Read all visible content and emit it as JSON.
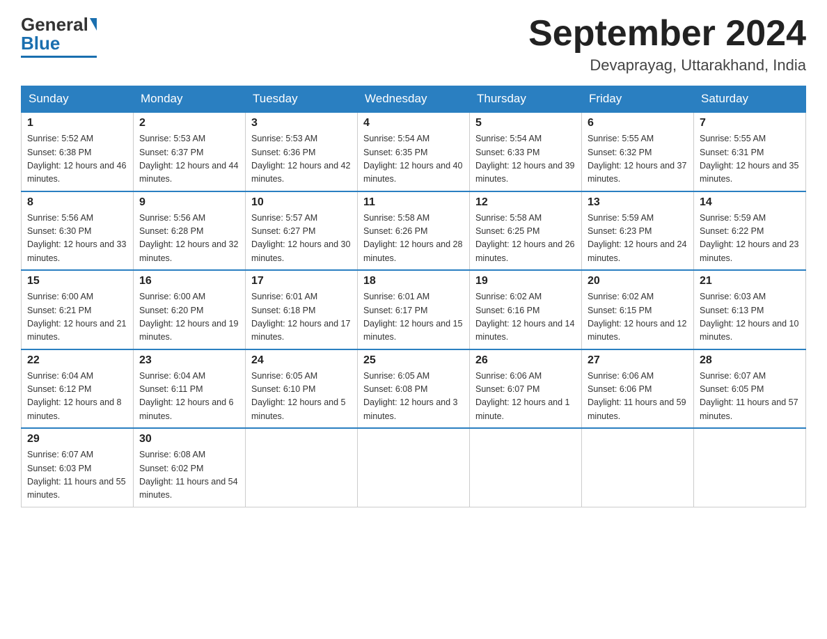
{
  "logo": {
    "general": "General",
    "blue": "Blue"
  },
  "title": "September 2024",
  "subtitle": "Devaprayag, Uttarakhand, India",
  "days_of_week": [
    "Sunday",
    "Monday",
    "Tuesday",
    "Wednesday",
    "Thursday",
    "Friday",
    "Saturday"
  ],
  "weeks": [
    [
      {
        "day": "1",
        "sunrise": "5:52 AM",
        "sunset": "6:38 PM",
        "daylight": "12 hours and 46 minutes."
      },
      {
        "day": "2",
        "sunrise": "5:53 AM",
        "sunset": "6:37 PM",
        "daylight": "12 hours and 44 minutes."
      },
      {
        "day": "3",
        "sunrise": "5:53 AM",
        "sunset": "6:36 PM",
        "daylight": "12 hours and 42 minutes."
      },
      {
        "day": "4",
        "sunrise": "5:54 AM",
        "sunset": "6:35 PM",
        "daylight": "12 hours and 40 minutes."
      },
      {
        "day": "5",
        "sunrise": "5:54 AM",
        "sunset": "6:33 PM",
        "daylight": "12 hours and 39 minutes."
      },
      {
        "day": "6",
        "sunrise": "5:55 AM",
        "sunset": "6:32 PM",
        "daylight": "12 hours and 37 minutes."
      },
      {
        "day": "7",
        "sunrise": "5:55 AM",
        "sunset": "6:31 PM",
        "daylight": "12 hours and 35 minutes."
      }
    ],
    [
      {
        "day": "8",
        "sunrise": "5:56 AM",
        "sunset": "6:30 PM",
        "daylight": "12 hours and 33 minutes."
      },
      {
        "day": "9",
        "sunrise": "5:56 AM",
        "sunset": "6:28 PM",
        "daylight": "12 hours and 32 minutes."
      },
      {
        "day": "10",
        "sunrise": "5:57 AM",
        "sunset": "6:27 PM",
        "daylight": "12 hours and 30 minutes."
      },
      {
        "day": "11",
        "sunrise": "5:58 AM",
        "sunset": "6:26 PM",
        "daylight": "12 hours and 28 minutes."
      },
      {
        "day": "12",
        "sunrise": "5:58 AM",
        "sunset": "6:25 PM",
        "daylight": "12 hours and 26 minutes."
      },
      {
        "day": "13",
        "sunrise": "5:59 AM",
        "sunset": "6:23 PM",
        "daylight": "12 hours and 24 minutes."
      },
      {
        "day": "14",
        "sunrise": "5:59 AM",
        "sunset": "6:22 PM",
        "daylight": "12 hours and 23 minutes."
      }
    ],
    [
      {
        "day": "15",
        "sunrise": "6:00 AM",
        "sunset": "6:21 PM",
        "daylight": "12 hours and 21 minutes."
      },
      {
        "day": "16",
        "sunrise": "6:00 AM",
        "sunset": "6:20 PM",
        "daylight": "12 hours and 19 minutes."
      },
      {
        "day": "17",
        "sunrise": "6:01 AM",
        "sunset": "6:18 PM",
        "daylight": "12 hours and 17 minutes."
      },
      {
        "day": "18",
        "sunrise": "6:01 AM",
        "sunset": "6:17 PM",
        "daylight": "12 hours and 15 minutes."
      },
      {
        "day": "19",
        "sunrise": "6:02 AM",
        "sunset": "6:16 PM",
        "daylight": "12 hours and 14 minutes."
      },
      {
        "day": "20",
        "sunrise": "6:02 AM",
        "sunset": "6:15 PM",
        "daylight": "12 hours and 12 minutes."
      },
      {
        "day": "21",
        "sunrise": "6:03 AM",
        "sunset": "6:13 PM",
        "daylight": "12 hours and 10 minutes."
      }
    ],
    [
      {
        "day": "22",
        "sunrise": "6:04 AM",
        "sunset": "6:12 PM",
        "daylight": "12 hours and 8 minutes."
      },
      {
        "day": "23",
        "sunrise": "6:04 AM",
        "sunset": "6:11 PM",
        "daylight": "12 hours and 6 minutes."
      },
      {
        "day": "24",
        "sunrise": "6:05 AM",
        "sunset": "6:10 PM",
        "daylight": "12 hours and 5 minutes."
      },
      {
        "day": "25",
        "sunrise": "6:05 AM",
        "sunset": "6:08 PM",
        "daylight": "12 hours and 3 minutes."
      },
      {
        "day": "26",
        "sunrise": "6:06 AM",
        "sunset": "6:07 PM",
        "daylight": "12 hours and 1 minute."
      },
      {
        "day": "27",
        "sunrise": "6:06 AM",
        "sunset": "6:06 PM",
        "daylight": "11 hours and 59 minutes."
      },
      {
        "day": "28",
        "sunrise": "6:07 AM",
        "sunset": "6:05 PM",
        "daylight": "11 hours and 57 minutes."
      }
    ],
    [
      {
        "day": "29",
        "sunrise": "6:07 AM",
        "sunset": "6:03 PM",
        "daylight": "11 hours and 55 minutes."
      },
      {
        "day": "30",
        "sunrise": "6:08 AM",
        "sunset": "6:02 PM",
        "daylight": "11 hours and 54 minutes."
      },
      null,
      null,
      null,
      null,
      null
    ]
  ],
  "labels": {
    "sunrise": "Sunrise:",
    "sunset": "Sunset:",
    "daylight": "Daylight:"
  }
}
